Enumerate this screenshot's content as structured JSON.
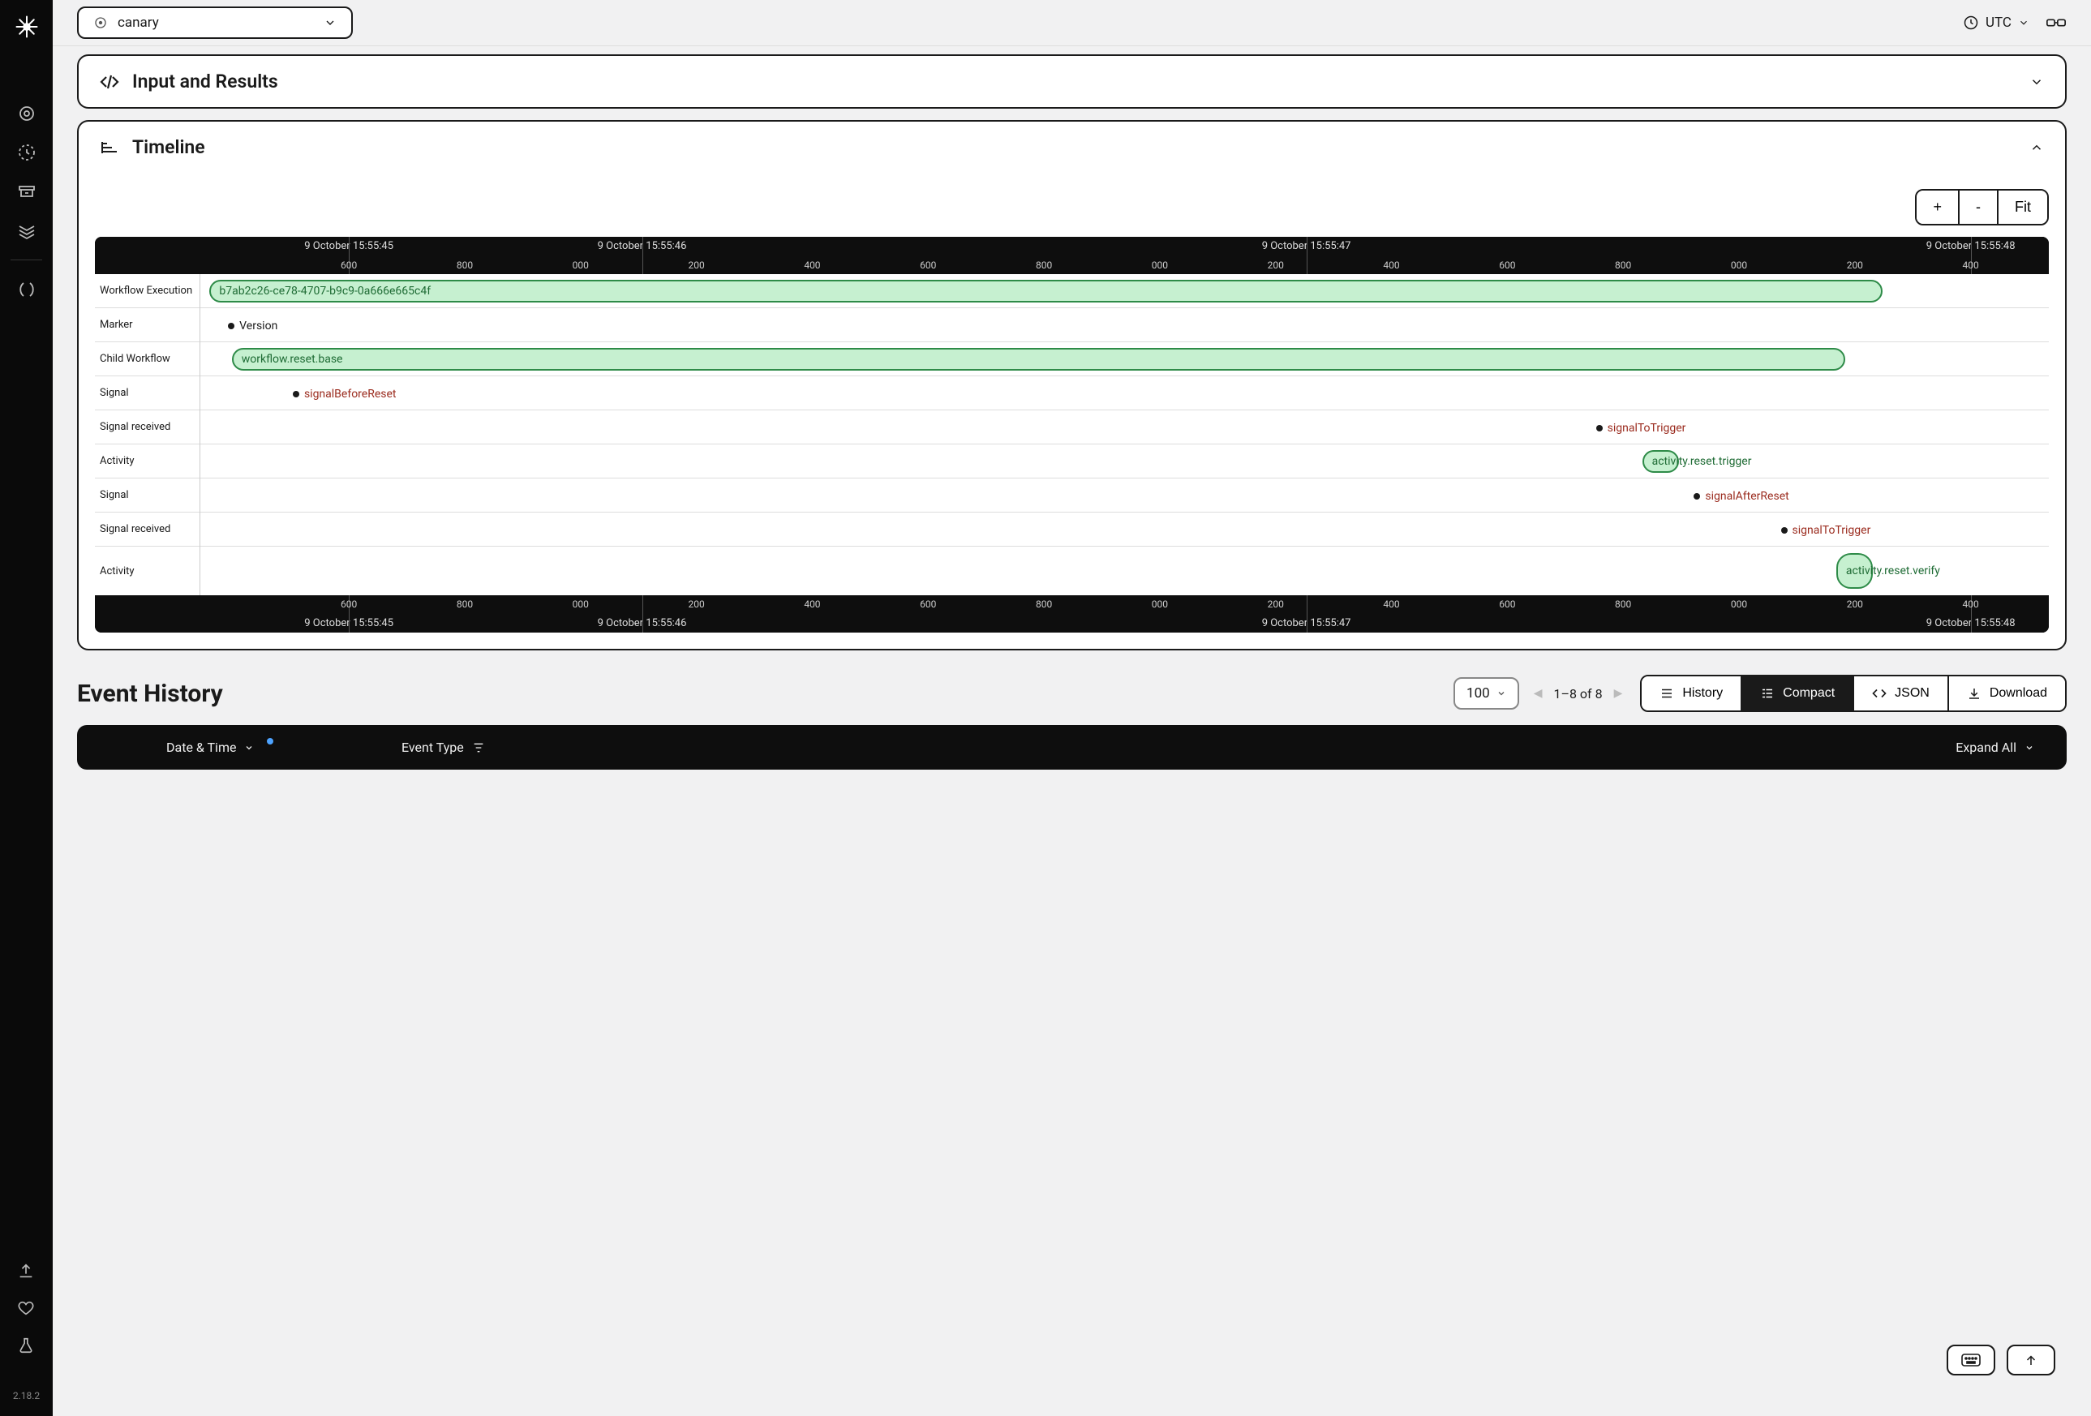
{
  "app": {
    "version": "2.18.2"
  },
  "topbar": {
    "namespace": "canary",
    "timezone": "UTC"
  },
  "panels": {
    "input_results": {
      "title": "Input and Results"
    },
    "timeline": {
      "title": "Timeline",
      "zoom": {
        "in": "+",
        "out": "-",
        "fit": "Fit"
      },
      "axis_major": [
        "9 October 15:55:45",
        "9 October 15:55:46",
        "9 October 15:55:47",
        "9 October 15:55:48"
      ],
      "axis_minor": [
        "600",
        "800",
        "000",
        "200",
        "400",
        "600",
        "800",
        "000",
        "200",
        "400",
        "600",
        "800",
        "000",
        "200",
        "400"
      ],
      "lanes": [
        {
          "label": "Workflow Execution",
          "type": "bar",
          "text": "b7ab2c26-ce78-4707-b9c9-0a666e665c4f",
          "start": 0.5,
          "end": 91,
          "color": "green"
        },
        {
          "label": "Marker",
          "type": "dot",
          "text": "Version",
          "pos": 1.5
        },
        {
          "label": "Child Workflow",
          "type": "bar",
          "text": "workflow.reset.base",
          "start": 1.7,
          "end": 89,
          "color": "green"
        },
        {
          "label": "Signal",
          "type": "dot",
          "text": "signalBeforeReset",
          "pos": 5,
          "class": "red"
        },
        {
          "label": "Signal received",
          "type": "dot",
          "text": "signalToTrigger",
          "pos": 75.5,
          "class": "red"
        },
        {
          "label": "Activity",
          "type": "bar",
          "text": "activity.reset.trigger",
          "start": 78,
          "end": 80,
          "color": "green",
          "overflow": true
        },
        {
          "label": "Signal",
          "type": "dot",
          "text": "signalAfterReset",
          "pos": 80.8,
          "class": "red"
        },
        {
          "label": "Signal received",
          "type": "dot",
          "text": "signalToTrigger",
          "pos": 85.5,
          "class": "red"
        },
        {
          "label": "Activity",
          "type": "bar",
          "text": "activity.reset.verify",
          "start": 88.5,
          "end": 89.4,
          "color": "green",
          "overflow": true,
          "tall": true
        }
      ]
    }
  },
  "event_history": {
    "title": "Event History",
    "page_size": "100",
    "range": "1–8 of 8",
    "views": {
      "history": "History",
      "compact": "Compact",
      "json": "JSON",
      "download": "Download"
    },
    "columns": {
      "date": "Date & Time",
      "event_type": "Event Type",
      "expand": "Expand All"
    }
  },
  "chart_data": {
    "type": "timeline",
    "title": "Timeline",
    "x_axis_labels": [
      "9 October 15:55:45",
      "9 October 15:55:46",
      "9 October 15:55:47",
      "9 October 15:55:48"
    ],
    "x_minor_ticks_ms": [
      600,
      800,
      0,
      200,
      400,
      600,
      800,
      0,
      200,
      400,
      600,
      800,
      0,
      200,
      400
    ],
    "lanes": [
      "Workflow Execution",
      "Marker",
      "Child Workflow",
      "Signal",
      "Signal received",
      "Activity",
      "Signal",
      "Signal received",
      "Activity"
    ],
    "time_range": {
      "start": "2024-10-09T15:55:44.600Z",
      "end": "2024-10-09T15:55:48.500Z"
    },
    "items": [
      {
        "lane": "Workflow Execution",
        "kind": "span",
        "label": "b7ab2c26-ce78-4707-b9c9-0a666e665c4f",
        "start": "15:55:44.600",
        "end": "15:55:48.150",
        "status": "completed"
      },
      {
        "lane": "Marker",
        "kind": "point",
        "label": "Version",
        "t": "15:55:44.640"
      },
      {
        "lane": "Child Workflow",
        "kind": "span",
        "label": "workflow.reset.base",
        "start": "15:55:44.650",
        "end": "15:55:48.080",
        "status": "completed"
      },
      {
        "lane": "Signal",
        "kind": "point",
        "label": "signalBeforeReset",
        "t": "15:55:44.780",
        "color": "red"
      },
      {
        "lane": "Signal received",
        "kind": "point",
        "label": "signalToTrigger",
        "t": "15:55:47.550",
        "color": "red"
      },
      {
        "lane": "Activity",
        "kind": "span",
        "label": "activity.reset.trigger",
        "start": "15:55:47.650",
        "end": "15:55:47.720",
        "status": "completed"
      },
      {
        "lane": "Signal",
        "kind": "point",
        "label": "signalAfterReset",
        "t": "15:55:47.760",
        "color": "red"
      },
      {
        "lane": "Signal received",
        "kind": "point",
        "label": "signalToTrigger",
        "t": "15:55:47.940",
        "color": "red"
      },
      {
        "lane": "Activity",
        "kind": "span",
        "label": "activity.reset.verify",
        "start": "15:55:48.060",
        "end": "15:55:48.090",
        "status": "completed"
      }
    ]
  }
}
